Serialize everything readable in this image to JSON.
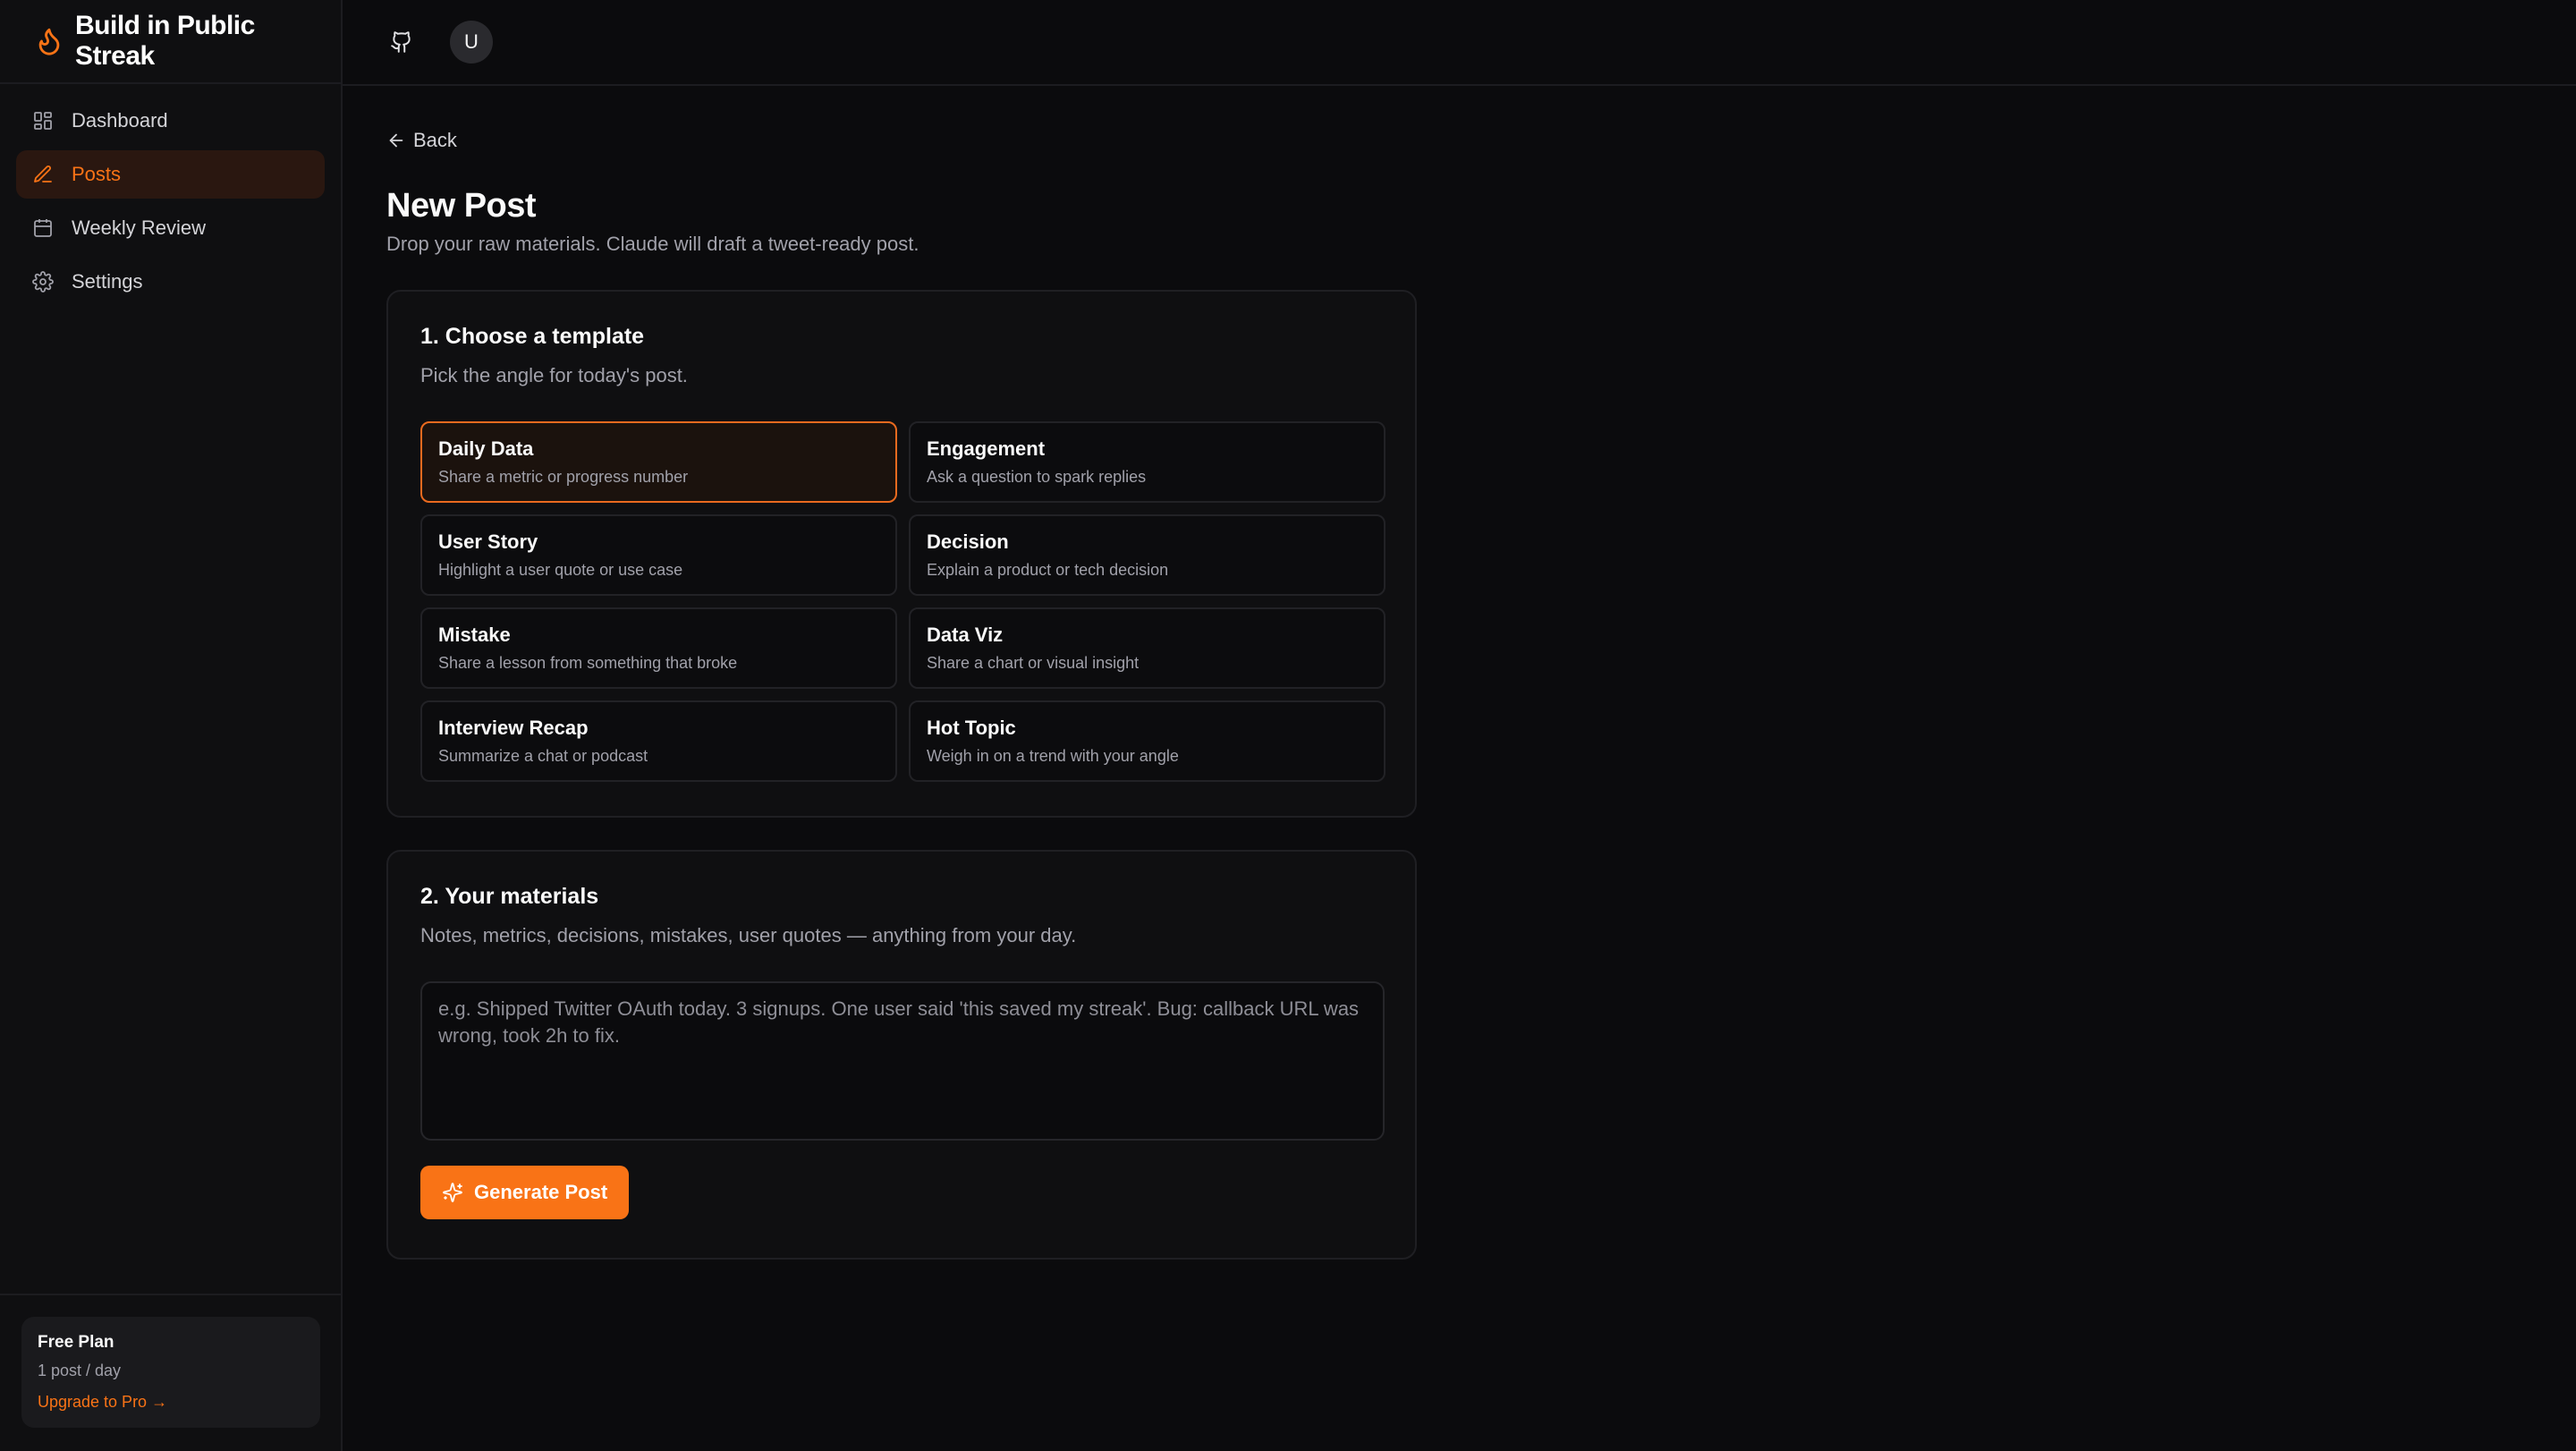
{
  "app": {
    "title": "Build in Public Streak",
    "logo_icon": "flame-icon",
    "accent": "#f97316"
  },
  "sidebar": {
    "items": [
      {
        "label": "Dashboard",
        "icon": "grid-icon",
        "active": false
      },
      {
        "label": "Posts",
        "icon": "pen-icon",
        "active": true
      },
      {
        "label": "Weekly Review",
        "icon": "calendar-icon",
        "active": false
      },
      {
        "label": "Settings",
        "icon": "gear-icon",
        "active": false
      }
    ],
    "plan": {
      "title": "Free Plan",
      "limit": "1 post / day",
      "upgrade": "Upgrade to Pro →"
    }
  },
  "topbar": {
    "github_icon": "github-icon",
    "avatar_initial": "U"
  },
  "main": {
    "back_label": "Back",
    "title": "New Post",
    "subtitle": "Drop your raw materials. Claude will draft a tweet-ready post.",
    "template_section": {
      "title": "1. Choose a template",
      "subtitle": "Pick the angle for today's post.",
      "templates": [
        {
          "name": "Daily Data",
          "desc": "Share a metric or progress number",
          "selected": true
        },
        {
          "name": "Engagement",
          "desc": "Ask a question to spark replies",
          "selected": false
        },
        {
          "name": "User Story",
          "desc": "Highlight a user quote or use case",
          "selected": false
        },
        {
          "name": "Decision",
          "desc": "Explain a product or tech decision",
          "selected": false
        },
        {
          "name": "Mistake",
          "desc": "Share a lesson from something that broke",
          "selected": false
        },
        {
          "name": "Data Viz",
          "desc": "Share a chart or visual insight",
          "selected": false
        },
        {
          "name": "Interview Recap",
          "desc": "Summarize a chat or podcast",
          "selected": false
        },
        {
          "name": "Hot Topic",
          "desc": "Weigh in on a trend with your angle",
          "selected": false
        }
      ]
    },
    "materials_section": {
      "title": "2. Your materials",
      "subtitle": "Notes, metrics, decisions, mistakes, user quotes — anything from your day.",
      "placeholder": "e.g. Shipped Twitter OAuth today. 3 signups. One user said 'this saved my streak'. Bug: callback URL was wrong, took 2h to fix.",
      "value": ""
    },
    "generate_label": "Generate Post"
  }
}
